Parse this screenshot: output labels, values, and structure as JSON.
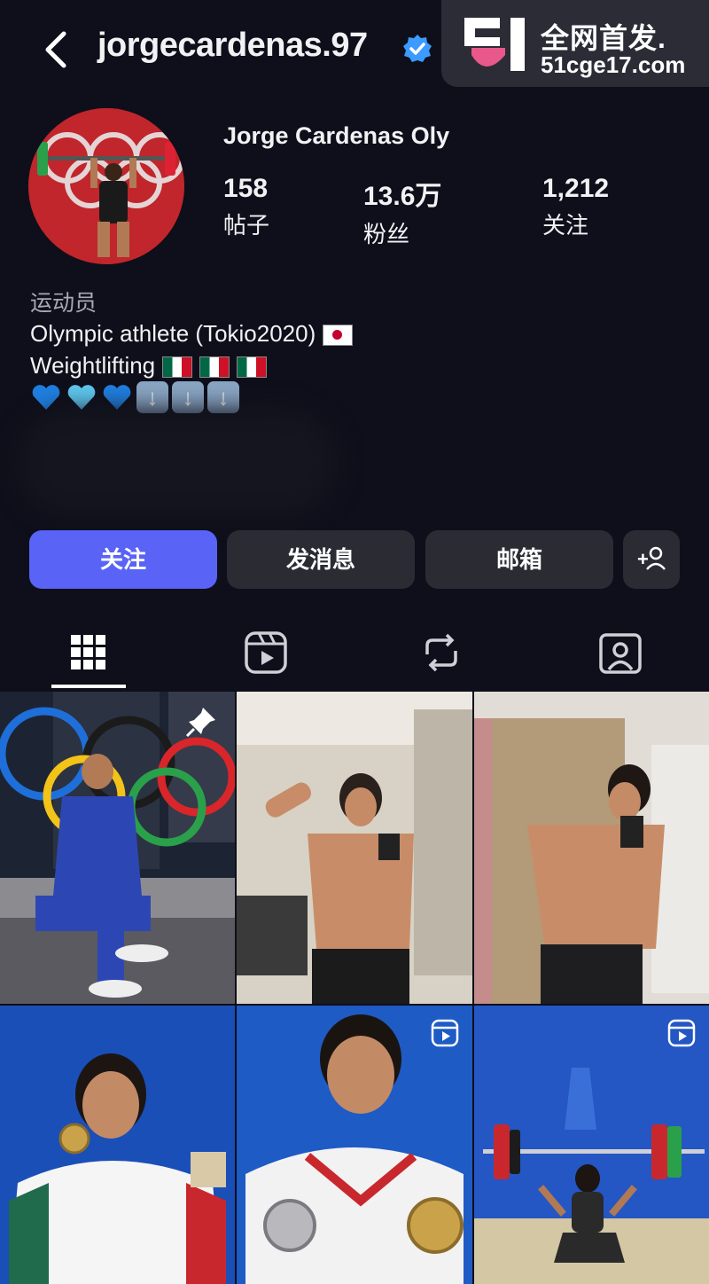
{
  "header": {
    "username": "jorgecardenas.97",
    "verified": true,
    "back_icon": "chevron-left-icon"
  },
  "watermark": {
    "line1": "全网首发.",
    "line2": "51cge17.com"
  },
  "profile": {
    "display_name": "Jorge Cardenas Oly",
    "stats": [
      {
        "value": "158",
        "label": "帖子"
      },
      {
        "value": "13.6万",
        "label": "粉丝"
      },
      {
        "value": "1,212",
        "label": "关注"
      }
    ]
  },
  "bio": {
    "category": "运动员",
    "line1": "Olympic athlete (Tokio2020)",
    "line2": "Weightlifting",
    "emojis": [
      "blue-heart",
      "light-blue-heart",
      "blue-heart",
      "down-arrow",
      "down-arrow",
      "down-arrow"
    ]
  },
  "actions": {
    "follow": "关注",
    "message": "发消息",
    "email": "邮箱",
    "add_user_icon": "add-user-icon"
  },
  "tabs": [
    "grid-icon",
    "reels-icon",
    "reposts-icon",
    "tagged-icon"
  ],
  "grid": {
    "posts": [
      {
        "kind": "photo",
        "pinned": true,
        "subject": "olympic-rings-seated"
      },
      {
        "kind": "photo",
        "pinned": false,
        "subject": "mirror-selfie-flex"
      },
      {
        "kind": "photo",
        "pinned": false,
        "subject": "mirror-selfie"
      },
      {
        "kind": "photo",
        "pinned": false,
        "subject": "medal-podium"
      },
      {
        "kind": "reel",
        "pinned": false,
        "subject": "two-medals"
      },
      {
        "kind": "reel",
        "pinned": false,
        "subject": "weightlifting-lift"
      }
    ]
  },
  "colors": {
    "background": "#0e0f1a",
    "primary_button": "#5963f6",
    "secondary_button": "#2a2b33",
    "verified_badge": "#3b9bff"
  }
}
